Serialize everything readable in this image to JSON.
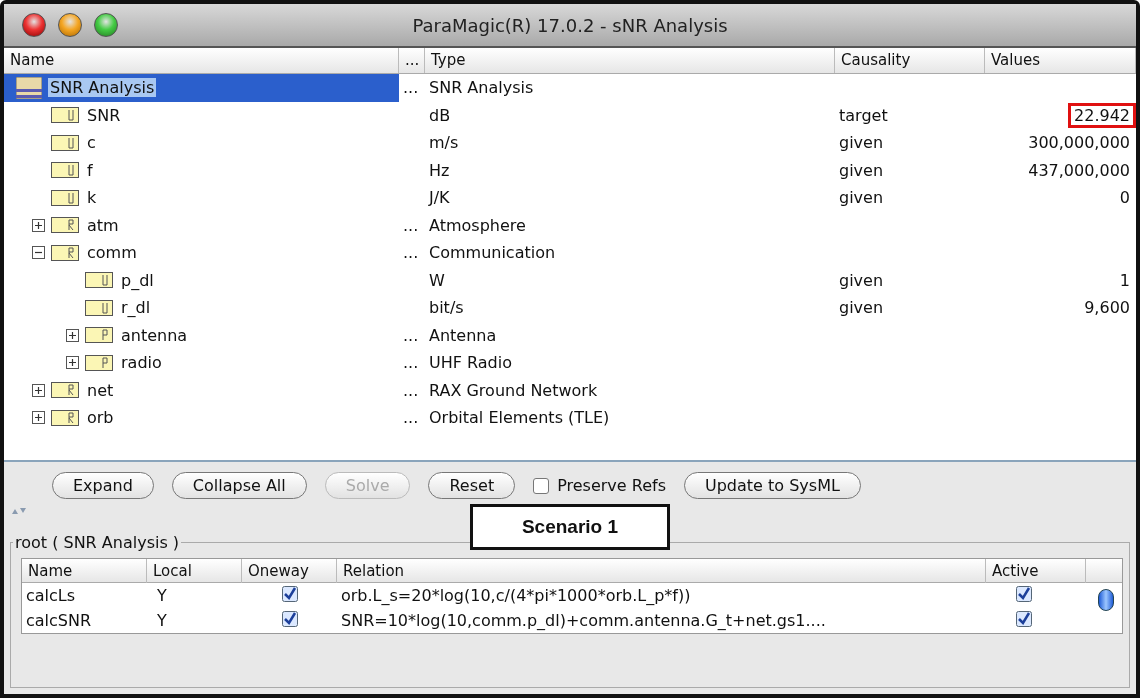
{
  "window": {
    "title": "ParaMagic(R) 17.0.2 - sNR Analysis"
  },
  "tree": {
    "columns": [
      {
        "label": "Name"
      },
      {
        "label": "..."
      },
      {
        "label": "Type"
      },
      {
        "label": "Causality"
      },
      {
        "label": "Values"
      }
    ],
    "rows": [
      {
        "kind": "root",
        "name": "SNR Analysis",
        "more": "...",
        "type": "SNR Analysis",
        "selected": true,
        "children": [
          {
            "kind": "value",
            "name": "SNR",
            "type": "dB",
            "causality": "target",
            "value": "22.942",
            "highlighted": true,
            "selected": false
          },
          {
            "kind": "value",
            "name": "c",
            "type": "m/s",
            "causality": "given",
            "value": "300,000,000",
            "highlighted": false,
            "selected": false
          },
          {
            "kind": "value",
            "name": "f",
            "type": "Hz",
            "causality": "given",
            "value": "437,000,000",
            "highlighted": false,
            "selected": false
          },
          {
            "kind": "value",
            "name": "k",
            "type": "J/K",
            "causality": "given",
            "value": "0",
            "highlighted": false,
            "selected": false
          },
          {
            "kind": "block",
            "name": "atm",
            "more": "...",
            "type": "Atmosphere",
            "expanded": false,
            "selected": false
          },
          {
            "kind": "block",
            "name": "comm",
            "more": "...",
            "type": "Communication",
            "expanded": true,
            "selected": false,
            "children": [
              {
                "kind": "value",
                "name": "p_dl",
                "type": "W",
                "causality": "given",
                "value": "1",
                "highlighted": false,
                "selected": false
              },
              {
                "kind": "value",
                "name": "r_dl",
                "type": "bit/s",
                "causality": "given",
                "value": "9,600",
                "highlighted": false,
                "selected": false
              },
              {
                "kind": "part",
                "name": "antenna",
                "more": "...",
                "type": "Antenna",
                "expanded": false,
                "selected": false
              },
              {
                "kind": "part",
                "name": "radio",
                "more": "...",
                "type": "UHF Radio",
                "expanded": false,
                "selected": false
              }
            ]
          },
          {
            "kind": "block",
            "name": "net",
            "more": "...",
            "type": "RAX Ground Network",
            "expanded": false,
            "selected": false
          },
          {
            "kind": "block",
            "name": "orb",
            "more": "...",
            "type": "Orbital Elements (TLE)",
            "expanded": false,
            "selected": false
          }
        ]
      }
    ]
  },
  "buttons": [
    {
      "label": "Expand",
      "disabled": false
    },
    {
      "label": "Collapse All",
      "disabled": false
    },
    {
      "label": "Solve",
      "disabled": true
    },
    {
      "label": "Reset",
      "disabled": false
    }
  ],
  "preserve_refs": {
    "label": "Preserve Refs",
    "checked": false
  },
  "update_button": {
    "label": "Update to SysML",
    "disabled": false
  },
  "callout": {
    "label": "Scenario 1"
  },
  "relations": {
    "legend": "root ( SNR Analysis )",
    "columns": [
      {
        "label": "Name"
      },
      {
        "label": "Local"
      },
      {
        "label": "Oneway"
      },
      {
        "label": "Relation"
      },
      {
        "label": "Active"
      }
    ],
    "rows": [
      {
        "name": "calcLs",
        "local": "Y",
        "oneway": true,
        "relation": "orb.L_s=20*log(10,c/(4*pi*1000*orb.L_p*f))",
        "active": true
      },
      {
        "name": "calcSNR",
        "local": "Y",
        "oneway": true,
        "relation": "SNR=10*log(10,comm.p_dl)+comm.antenna.G_t+net.gs1....",
        "active": true
      }
    ]
  }
}
